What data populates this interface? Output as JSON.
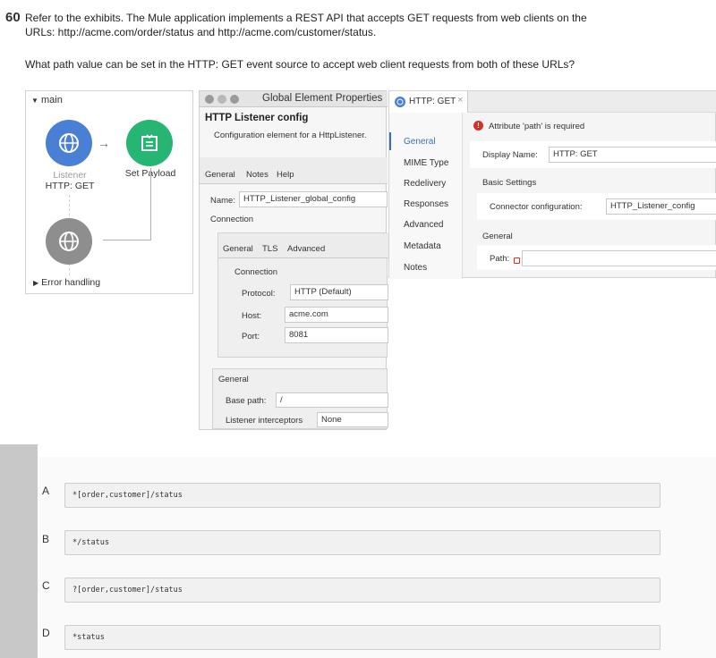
{
  "question": {
    "number": "60",
    "line1": "Refer to the exhibits. The Mule application implements a REST API that accepts GET requests from web clients on the",
    "line2": "URLs: http://acme.com/order/status and http://acme.com/customer/status.",
    "line3": "What path value can be set in the HTTP: GET event source to accept web client requests from both of these URLs?"
  },
  "flow": {
    "title": "main",
    "listener_caption": "Listener",
    "listener_name": "HTTP: GET",
    "set_payload": "Set Payload",
    "error_handling": "Error handling"
  },
  "gep": {
    "window_title": "Global Element Properties",
    "heading": "HTTP Listener config",
    "subheading": "Configuration element for a HttpListener.",
    "tabs": [
      "General",
      "Notes",
      "Help"
    ],
    "name_label": "Name:",
    "name_value": "HTTP_Listener_global_config",
    "connection_label": "Connection",
    "inner_tabs": [
      "General",
      "TLS",
      "Advanced"
    ],
    "inner_connection": "Connection",
    "protocol_label": "Protocol:",
    "protocol_value": "HTTP (Default)",
    "host_label": "Host:",
    "host_value": "acme.com",
    "port_label": "Port:",
    "port_value": "8081",
    "general_label": "General",
    "basepath_label": "Base path:",
    "basepath_value": "/",
    "interceptors_label": "Listener interceptors",
    "interceptors_value": "None"
  },
  "http_panel": {
    "tab_label": "HTTP: GET",
    "nav": [
      "General",
      "MIME Type",
      "Redelivery",
      "Responses",
      "Advanced",
      "Metadata",
      "Notes"
    ],
    "error": "Attribute 'path' is required",
    "display_name_label": "Display Name:",
    "display_name_value": "HTTP: GET",
    "basic_settings": "Basic Settings",
    "connector_label": "Connector configuration:",
    "connector_value": "HTTP_Listener_config",
    "general": "General",
    "path_label": "Path:",
    "path_value": ""
  },
  "options": [
    {
      "letter": "A",
      "text": "*[order,customer]/status"
    },
    {
      "letter": "B",
      "text": "*/status"
    },
    {
      "letter": "C",
      "text": "?[order,customer]/status"
    },
    {
      "letter": "D",
      "text": "*status"
    }
  ],
  "colors": {
    "listener_blue": "#4a7fd6",
    "payload_green": "#27b573",
    "error_gray": "#8e8e8e",
    "accent_blue": "#3a6fb5",
    "error_red": "#d93025"
  }
}
